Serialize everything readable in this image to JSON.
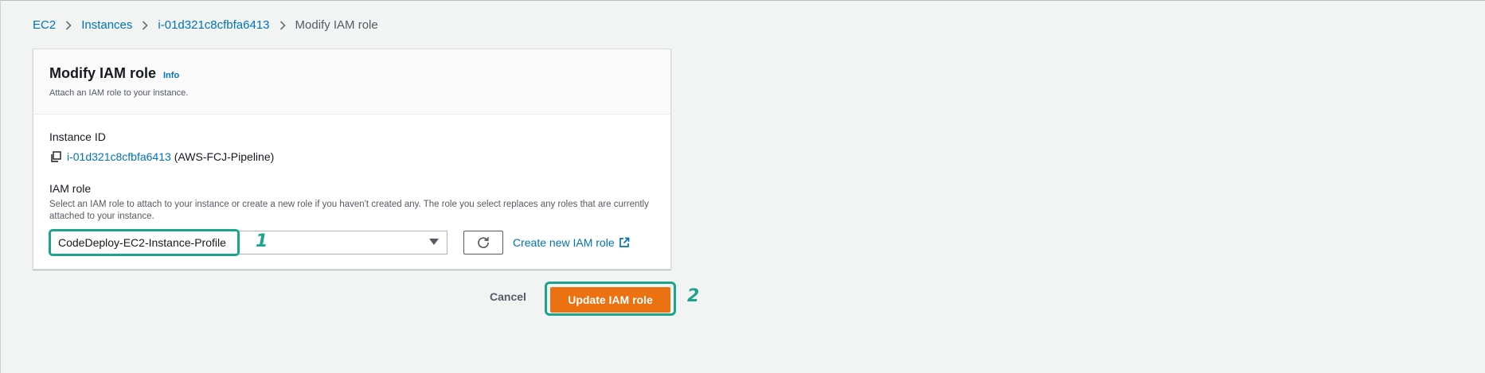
{
  "breadcrumb": {
    "items": [
      {
        "label": "EC2"
      },
      {
        "label": "Instances"
      },
      {
        "label": "i-01d321c8cfbfa6413"
      },
      {
        "label": "Modify IAM role"
      }
    ]
  },
  "panel": {
    "title": "Modify IAM role",
    "info_label": "Info",
    "description": "Attach an IAM role to your instance."
  },
  "instance": {
    "label": "Instance ID",
    "id": "i-01d321c8cfbfa6413",
    "name": "(AWS-FCJ-Pipeline)"
  },
  "iam_role": {
    "label": "IAM role",
    "description": "Select an IAM role to attach to your instance or create a new role if you haven't created any. The role you select replaces any roles that are currently attached to your instance.",
    "selected_value": "CodeDeploy-EC2-Instance-Profile",
    "create_link_label": "Create new IAM role"
  },
  "actions": {
    "cancel_label": "Cancel",
    "update_label": "Update IAM role"
  },
  "annotations": {
    "step_1": "1",
    "step_2": "2"
  },
  "colors": {
    "link": "#0073bb",
    "primary_button": "#ec7211",
    "annotation": "#1ca48d"
  },
  "icons": [
    "chevron-right-icon",
    "copy-icon",
    "caret-down-icon",
    "refresh-icon",
    "external-link-icon"
  ]
}
